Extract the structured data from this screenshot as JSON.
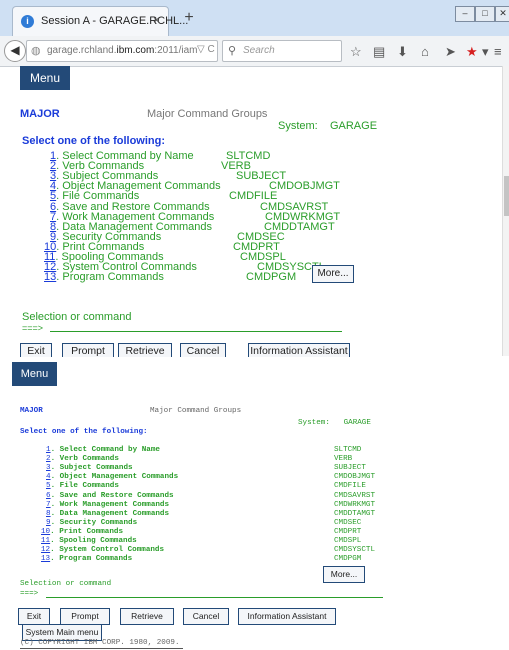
{
  "browser": {
    "tab_title": "Session A - GARAGE.RCHL...",
    "new_tab": "+",
    "tab_close": "×",
    "url_pre": "garage.rchland.",
    "url_domain": "ibm.com",
    "url_post": ":2011/iam",
    "search_placeholder": "Search"
  },
  "panel_top": {
    "menu_label": "Menu",
    "major": "MAJOR",
    "title": "Major Command Groups",
    "system_label": "System:",
    "system_name": "GARAGE",
    "select_prompt": "Select one of the following:",
    "items": [
      {
        "num": "1",
        "label": ". Select Command by Name",
        "cmd": "SLTCMD"
      },
      {
        "num": "2",
        "label": ". Verb Commands",
        "cmd": "VERB"
      },
      {
        "num": "3",
        "label": ". Subject Commands",
        "cmd": "SUBJECT"
      },
      {
        "num": "4",
        "label": ". Object Management Commands",
        "cmd": "CMDOBJMGT"
      },
      {
        "num": "5",
        "label": ". File Commands",
        "cmd": "CMDFILE"
      },
      {
        "num": "6",
        "label": ". Save and Restore Commands",
        "cmd": "CMDSAVRST"
      },
      {
        "num": "7",
        "label": ". Work Management Commands",
        "cmd": "CMDWRKMGT"
      },
      {
        "num": "8",
        "label": ". Data Management Commands",
        "cmd": "CMDDTAMGT"
      },
      {
        "num": "9",
        "label": ". Security Commands",
        "cmd": "CMDSEC"
      },
      {
        "num": "10",
        "label": ". Print Commands",
        "cmd": "CMDPRT"
      },
      {
        "num": "11",
        "label": ". Spooling Commands",
        "cmd": "CMDSPL"
      },
      {
        "num": "12",
        "label": ". System Control Commands",
        "cmd": "CMDSYSCTL"
      },
      {
        "num": "13",
        "label": ". Program Commands",
        "cmd": "CMDPGM"
      }
    ],
    "more_label": "More...",
    "selection_label": "Selection or command",
    "prompt_arrow": "===>",
    "keys": {
      "exit": "Exit",
      "prompt": "Prompt",
      "retrieve": "Retrieve",
      "cancel": "Cancel",
      "assistant": "Information Assistant"
    }
  },
  "panel_bottom": {
    "menu_label": "Menu",
    "major": "MAJOR",
    "title": "Major Command Groups",
    "system_label": "System:",
    "system_name": "GARAGE",
    "select_prompt": "Select one of the following:",
    "items": [
      {
        "num": "1",
        "label": ". Select Command by Name",
        "cmd": "SLTCMD"
      },
      {
        "num": "2",
        "label": ". Verb Commands",
        "cmd": "VERB"
      },
      {
        "num": "3",
        "label": ". Subject Commands",
        "cmd": "SUBJECT"
      },
      {
        "num": "4",
        "label": ". Object Management Commands",
        "cmd": "CMDOBJMGT"
      },
      {
        "num": "5",
        "label": ". File Commands",
        "cmd": "CMDFILE"
      },
      {
        "num": "6",
        "label": ". Save and Restore Commands",
        "cmd": "CMDSAVRST"
      },
      {
        "num": "7",
        "label": ". Work Management Commands",
        "cmd": "CMDWRKMGT"
      },
      {
        "num": "8",
        "label": ". Data Management Commands",
        "cmd": "CMDDTAMGT"
      },
      {
        "num": "9",
        "label": ". Security Commands",
        "cmd": "CMDSEC"
      },
      {
        "num": "10",
        "label": ". Print Commands",
        "cmd": "CMDPRT"
      },
      {
        "num": "11",
        "label": ". Spooling Commands",
        "cmd": "CMDSPL"
      },
      {
        "num": "12",
        "label": ". System Control Commands",
        "cmd": "CMDSYSCTL"
      },
      {
        "num": "13",
        "label": ". Program Commands",
        "cmd": "CMDPGM"
      }
    ],
    "more_label": "More...",
    "selection_label": "Selection or command",
    "prompt_arrow": "===>",
    "keys": {
      "exit": "Exit",
      "prompt": "Prompt",
      "retrieve": "Retrieve",
      "cancel": "Cancel",
      "assistant": "Information Assistant",
      "system_main_menu": "System Main menu"
    },
    "copyright": "(C) COPYRIGHT IBM CORP. 1980, 2009."
  },
  "colors": {
    "accent_navy": "#234a78",
    "text_blue": "#1a3bd9",
    "text_green": "#2a9d2a"
  }
}
